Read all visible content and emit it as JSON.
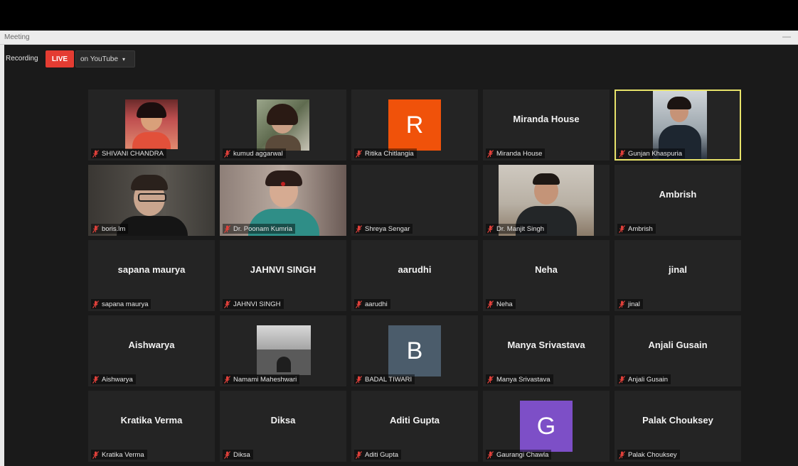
{
  "window": {
    "title": "Meeting"
  },
  "toolbar": {
    "recording": "Recording",
    "live": "LIVE",
    "stream": "on YouTube",
    "stream_caret": "▾"
  },
  "theme": {
    "active_border": "#e8e36a",
    "live_red": "#e43c32",
    "tile_bg": "#242424"
  },
  "participants": [
    {
      "label": "SHIVANI CHANDRA",
      "video": "photo"
    },
    {
      "label": "kumud aggarwal",
      "video": "photo"
    },
    {
      "label": "Ritika Chitlangia",
      "avatar_letter": "R",
      "avatar_color": "#f0520a"
    },
    {
      "label": "Miranda House",
      "center_name": "Miranda House"
    },
    {
      "label": "Gunjan Khaspuria",
      "video": "camera",
      "active_speaker": true
    },
    {
      "label": "boris.lm",
      "video": "camera"
    },
    {
      "label": "Dr. Poonam Kumria",
      "video": "camera"
    },
    {
      "label": "Shreya Sengar",
      "video": "off"
    },
    {
      "label": "Dr. Manjit Singh",
      "video": "camera"
    },
    {
      "label": "Ambrish",
      "center_name": "Ambrish"
    },
    {
      "label": "sapana maurya",
      "center_name": "sapana maurya"
    },
    {
      "label": "JAHNVI SINGH",
      "center_name": "JAHNVI SINGH"
    },
    {
      "label": "aarudhi",
      "center_name": "aarudhi"
    },
    {
      "label": "Neha",
      "center_name": "Neha"
    },
    {
      "label": "jinal",
      "center_name": "jinal"
    },
    {
      "label": "Aishwarya",
      "center_name": "Aishwarya"
    },
    {
      "label": "Namami Maheshwari",
      "video": "photo"
    },
    {
      "label": "BADAL TIWARI",
      "avatar_letter": "B",
      "avatar_color": "#4b5c6b"
    },
    {
      "label": "Manya Srivastava",
      "center_name": "Manya Srivastava"
    },
    {
      "label": "Anjali Gusain",
      "center_name": "Anjali Gusain"
    },
    {
      "label": "Kratika Verma",
      "center_name": "Kratika Verma"
    },
    {
      "label": "Diksa",
      "center_name": "Diksa"
    },
    {
      "label": "Aditi Gupta",
      "center_name": "Aditi Gupta"
    },
    {
      "label": "Gaurangi Chawla",
      "avatar_letter": "G",
      "avatar_color": "#7d4fc7"
    },
    {
      "label": "Palak Chouksey",
      "center_name": "Palak Chouksey"
    }
  ],
  "icons": {
    "muted_mic": "muted-mic-icon"
  }
}
